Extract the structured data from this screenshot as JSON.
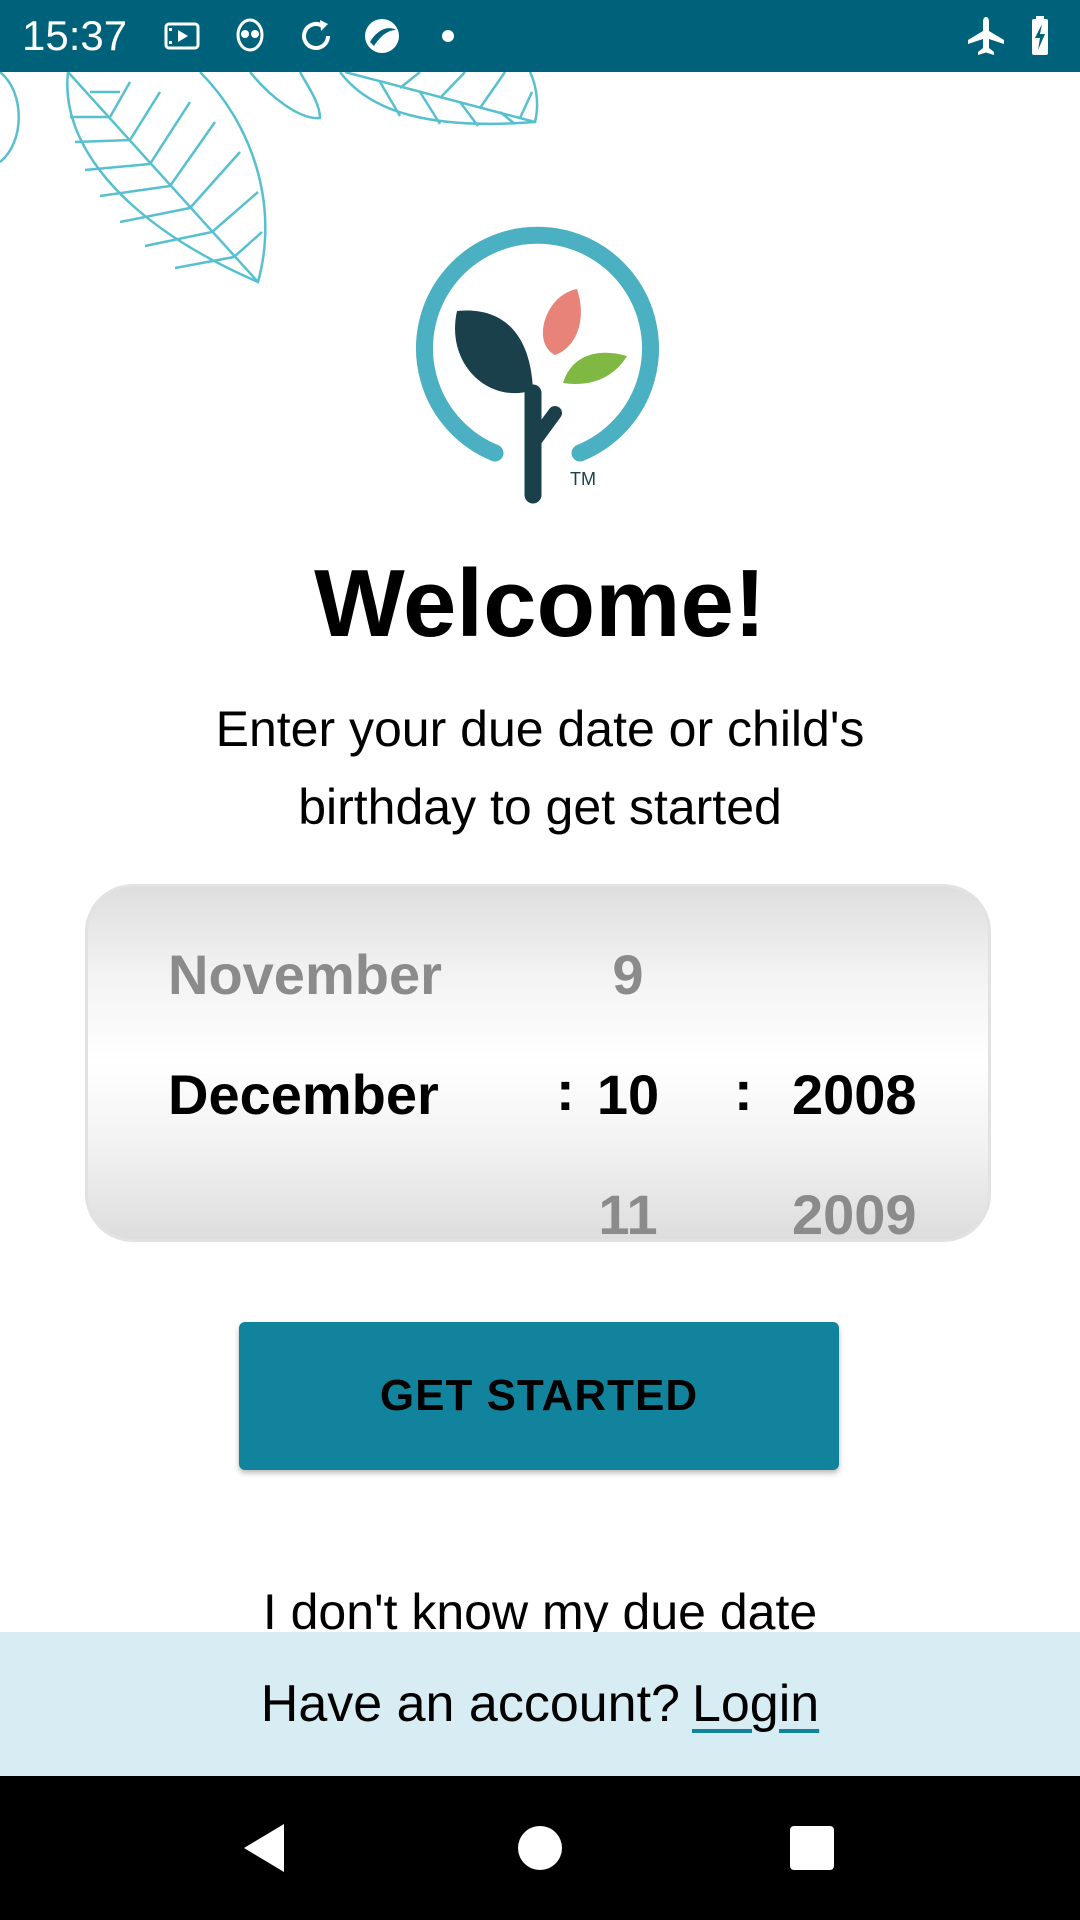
{
  "status_bar": {
    "time": "15:37",
    "left_icons": [
      "media-icon",
      "alien-icon",
      "sync-icon",
      "app-icon",
      "dot-icon"
    ],
    "right_icons": [
      "airplane-mode-icon",
      "battery-charging-icon"
    ]
  },
  "brand": {
    "logo_icon": "sprout-logo-icon",
    "trademark": "TM",
    "colors": {
      "ring": "#4ab0c2",
      "leaf_dark": "#19404b",
      "leaf_red": "#e8837a",
      "leaf_green": "#7fb843"
    }
  },
  "welcome": {
    "title": "Welcome!",
    "subtitle_line1": "Enter your due date or child's",
    "subtitle_line2": "birthday to get started"
  },
  "date_picker": {
    "month": {
      "prev": "November",
      "selected": "December",
      "next": ""
    },
    "day": {
      "prev": "9",
      "selected": "10",
      "next": "11"
    },
    "year": {
      "prev": "",
      "selected": "2008",
      "next": "2009"
    },
    "separator": ":"
  },
  "actions": {
    "get_started": "GET STARTED",
    "unknown_due_date": "I don't know my due date"
  },
  "footer": {
    "question": "Have an account?",
    "login": "Login"
  },
  "colors": {
    "status_bar": "#00627a",
    "button": "#12839d",
    "footer_bg": "#d8edf3"
  },
  "nav": [
    "back-icon",
    "home-icon",
    "recents-icon"
  ]
}
